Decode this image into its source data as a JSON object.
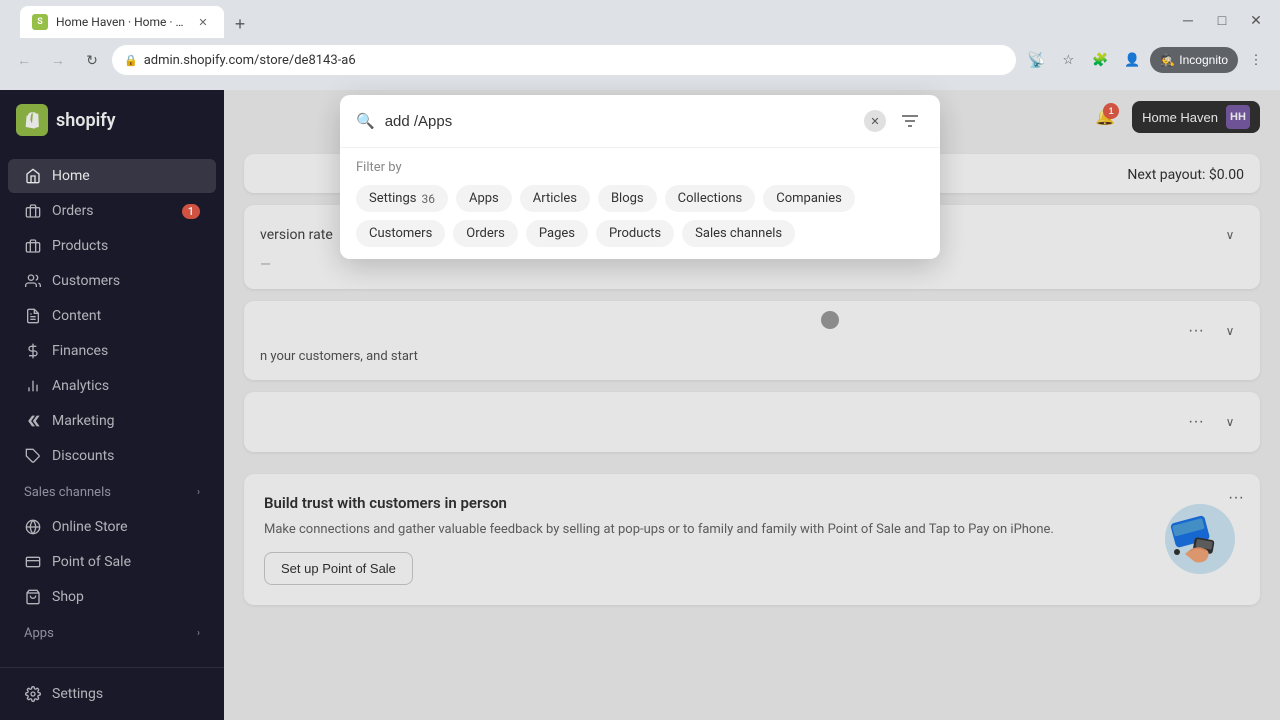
{
  "browser": {
    "tab_title": "Home Haven · Home · Shopify",
    "favicon_text": "S",
    "address": "admin.shopify.com/store/de8143-a6",
    "incognito_label": "Incognito"
  },
  "sidebar": {
    "logo_text": "shopify",
    "logo_mark": "S",
    "nav_items": [
      {
        "id": "home",
        "label": "Home",
        "icon": "🏠"
      },
      {
        "id": "orders",
        "label": "Orders",
        "icon": "📦",
        "badge": "1"
      },
      {
        "id": "products",
        "label": "Products",
        "icon": "🏷️"
      },
      {
        "id": "customers",
        "label": "Customers",
        "icon": "👤"
      },
      {
        "id": "content",
        "label": "Content",
        "icon": "📄"
      },
      {
        "id": "finances",
        "label": "Finances",
        "icon": "📊"
      },
      {
        "id": "analytics",
        "label": "Analytics",
        "icon": "📈"
      },
      {
        "id": "marketing",
        "label": "Marketing",
        "icon": "📣"
      },
      {
        "id": "discounts",
        "label": "Discounts",
        "icon": "🏷"
      }
    ],
    "sections": [
      {
        "id": "sales-channels",
        "label": "Sales channels",
        "items": [
          {
            "id": "online-store",
            "label": "Online Store",
            "icon": "🌐"
          },
          {
            "id": "point-of-sale",
            "label": "Point of Sale",
            "icon": "💳"
          },
          {
            "id": "shop",
            "label": "Shop",
            "icon": "🛍️"
          }
        ]
      },
      {
        "id": "apps",
        "label": "Apps",
        "items": []
      }
    ],
    "settings_label": "Settings"
  },
  "topbar": {
    "notification_count": "1",
    "store_name": "Home Haven",
    "store_initials": "HH"
  },
  "search_modal": {
    "input_placeholder": "add /Apps",
    "input_value": "add /Apps",
    "filter_by_label": "Filter by",
    "filter_tags": [
      {
        "id": "settings",
        "label": "Settings",
        "count": "36"
      },
      {
        "id": "apps",
        "label": "Apps",
        "count": null
      },
      {
        "id": "articles",
        "label": "Articles",
        "count": null
      },
      {
        "id": "blogs",
        "label": "Blogs",
        "count": null
      },
      {
        "id": "collections",
        "label": "Collections",
        "count": null
      },
      {
        "id": "companies",
        "label": "Companies",
        "count": null
      },
      {
        "id": "customers",
        "label": "Customers",
        "count": null
      },
      {
        "id": "orders",
        "label": "Orders",
        "count": null
      },
      {
        "id": "pages",
        "label": "Pages",
        "count": null
      },
      {
        "id": "products",
        "label": "Products",
        "count": null
      },
      {
        "id": "sales-channels",
        "label": "Sales channels",
        "count": null
      }
    ]
  },
  "dashboard": {
    "payout_label": "Next payout: $0.00",
    "conversion_label": "version rate",
    "bottom_card": {
      "title": "Build trust with customers in person",
      "description": "Make connections and gather valuable feedback by selling at pop-ups or to family and family with Point of Sale and Tap to Pay on iPhone.",
      "cta_label": "Set up Point of Sale",
      "menu_label": "···"
    }
  }
}
